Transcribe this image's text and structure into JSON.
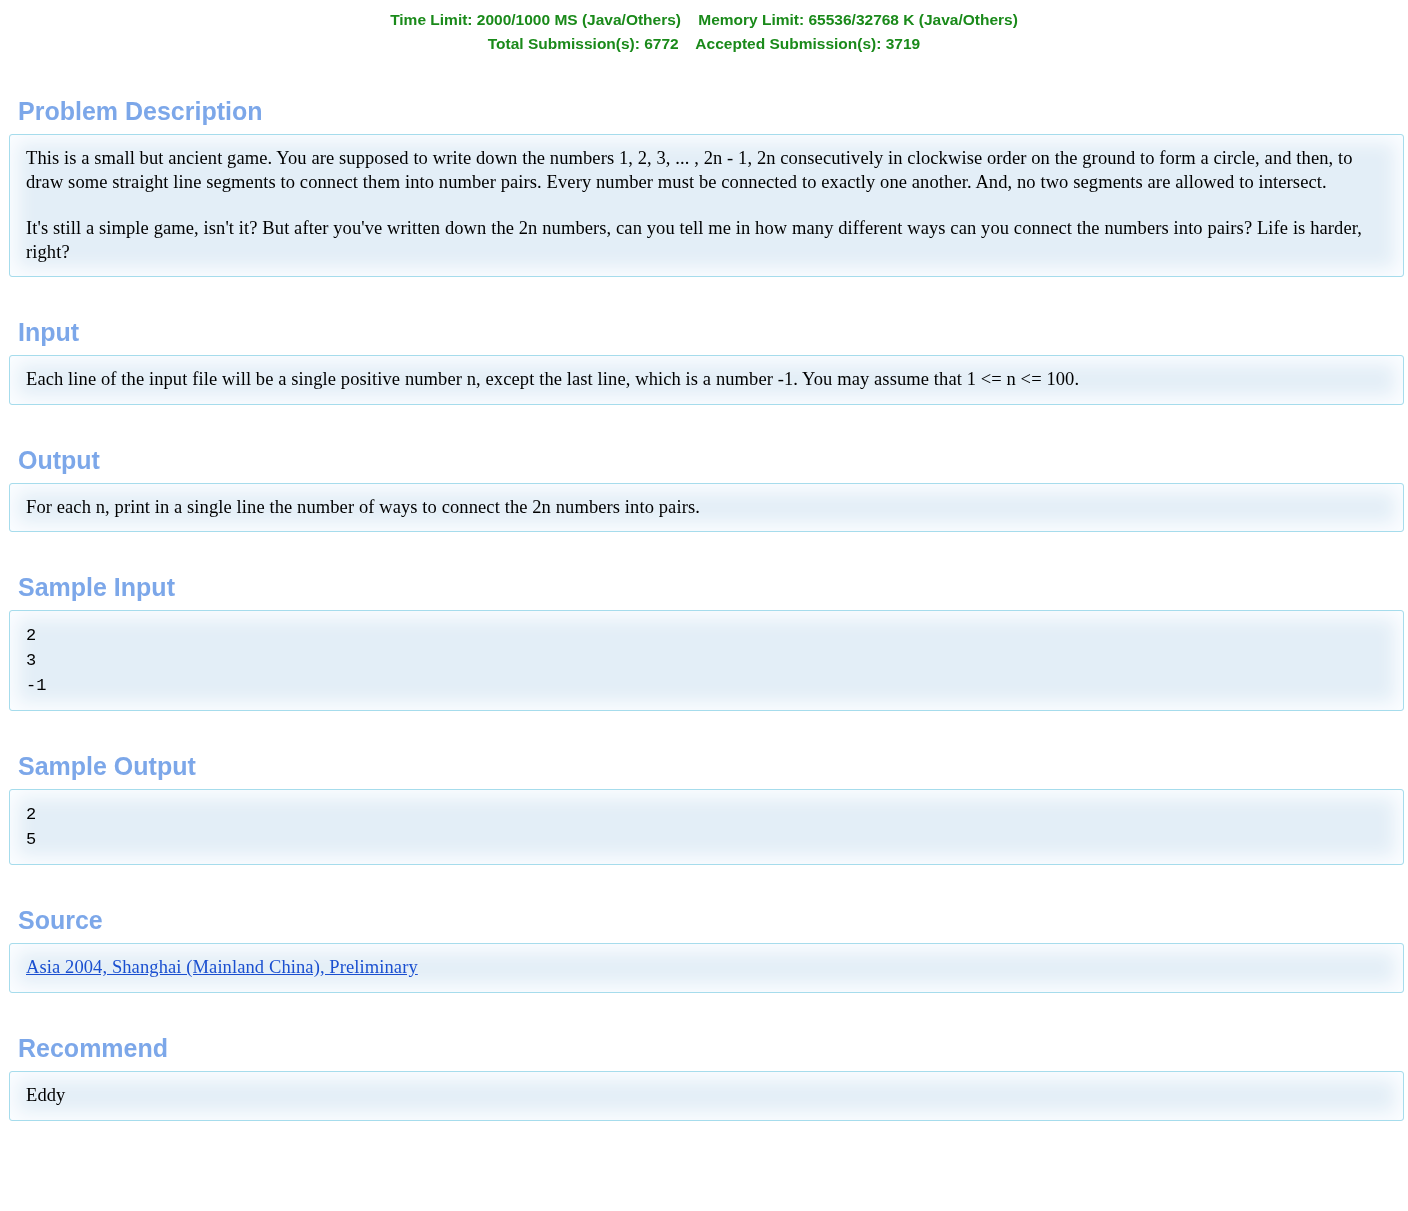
{
  "header": {
    "lines": [
      "Time Limit: 2000/1000 MS (Java/Others)    Memory Limit: 65536/32768 K (Java/Others)",
      "Total Submission(s): 6772    Accepted Submission(s): 3719"
    ]
  },
  "sections": [
    {
      "title": "Problem Description",
      "kind": "text",
      "paragraphs": [
        "This is a small but ancient game. You are supposed to write down the numbers 1, 2, 3, ... , 2n - 1, 2n consecutively in clockwise order on the ground to form a circle, and then, to draw some straight line segments to connect them into number pairs. Every number must be connected to exactly one another. And, no two segments are allowed to intersect.",
        "It's still a simple game, isn't it? But after you've written down the 2n numbers, can you tell me in how many different ways can you connect the numbers into pairs? Life is harder, right?"
      ]
    },
    {
      "title": "Input",
      "kind": "text",
      "paragraphs": [
        "Each line of the input file will be a single positive number n, except the last line, which is a number -1. You may assume that 1 <= n <= 100."
      ]
    },
    {
      "title": "Output",
      "kind": "text",
      "paragraphs": [
        "For each n, print in a single line the number of ways to connect the 2n numbers into pairs."
      ]
    },
    {
      "title": "Sample Input",
      "kind": "code",
      "lines": [
        "2",
        "3",
        "-1"
      ]
    },
    {
      "title": "Sample Output",
      "kind": "code",
      "lines": [
        "2",
        "5"
      ]
    },
    {
      "title": "Source",
      "kind": "link",
      "paragraphs": [
        "Asia 2004, Shanghai (Mainland China), Preliminary"
      ]
    },
    {
      "title": "Recommend",
      "kind": "text",
      "paragraphs": [
        "Eddy"
      ]
    }
  ]
}
